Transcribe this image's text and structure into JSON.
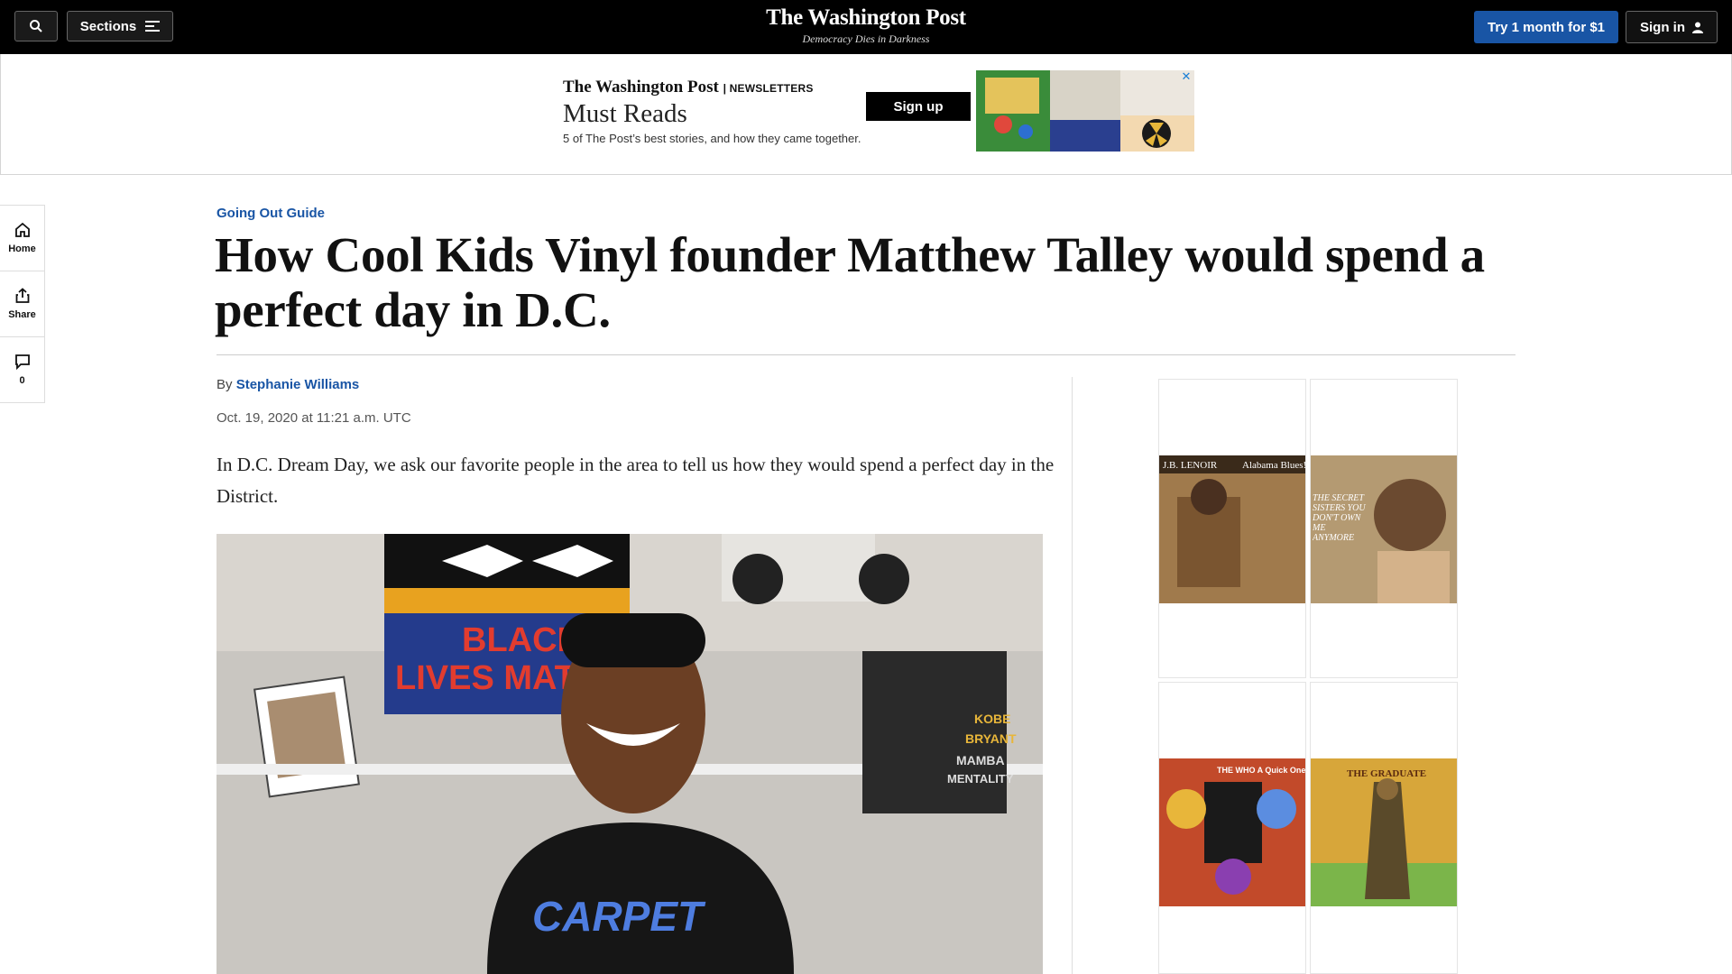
{
  "topbar": {
    "sections_label": "Sections",
    "logo": "The Washington Post",
    "tagline": "Democracy Dies in Darkness",
    "try_label": "Try 1 month for $1",
    "signin_label": "Sign in"
  },
  "top_ad": {
    "brand": "The Washington Post",
    "brand_suffix": "| NEWSLETTERS",
    "title": "Must Reads",
    "subtitle": "5 of The Post’s best stories, and how they came together.",
    "signup_label": "Sign up",
    "close_label": "✕"
  },
  "rail": {
    "home_label": "Home",
    "share_label": "Share",
    "comments_count": "0"
  },
  "article": {
    "kicker": "Going Out Guide",
    "headline": "How Cool Kids Vinyl founder Matthew Talley would spend a perfect day in D.C.",
    "by_prefix": "By",
    "author": "Stephanie Williams",
    "date": "Oct. 19, 2020 at 11:21 a.m. UTC",
    "lede": "In D.C. Dream Day, we ask our favorite people in the area to tell us how they would spend a perfect day in the District."
  },
  "photo": {
    "sign_line1": "BLACK",
    "sign_line2": "LIVES MAT",
    "book_line1": "KOBE",
    "book_line2": "BRYANT",
    "book_line3": "MAMBA",
    "book_line4": "MENTALITY",
    "shirt_text": "CARPET"
  },
  "side_ad": {
    "close_label": "✕",
    "albums": [
      {
        "title": "Alabama Blues!",
        "prefix": "J.B. LENOIR",
        "color": "#a07a4c"
      },
      {
        "title": "THE SECRET SISTERS YOU DON'T OWN ME ANYMORE",
        "color": "#b49a72"
      },
      {
        "title": "THE WHO A Quick One",
        "color": "#c24a2a"
      },
      {
        "title": "THE GRADUATE",
        "color": "#d7a63a"
      }
    ]
  }
}
